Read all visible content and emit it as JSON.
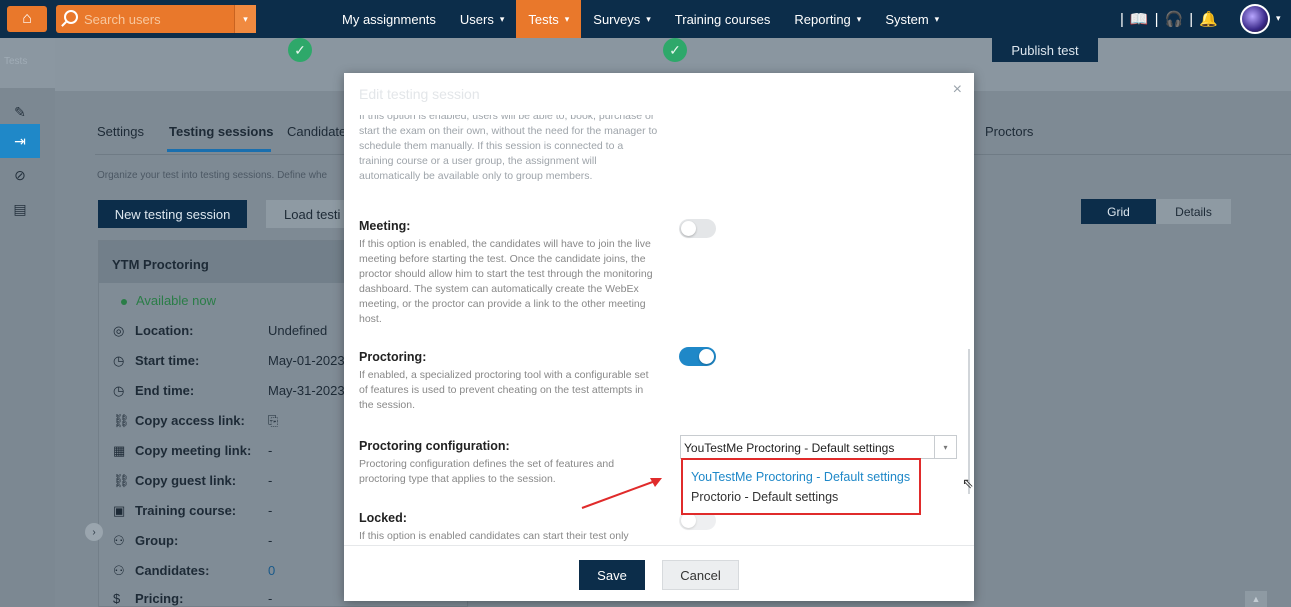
{
  "topbar": {
    "search_placeholder": "Search users",
    "nav": [
      {
        "label": "My assignments",
        "caret": false,
        "active": false
      },
      {
        "label": "Users",
        "caret": true,
        "active": false
      },
      {
        "label": "Tests",
        "caret": true,
        "active": true
      },
      {
        "label": "Surveys",
        "caret": true,
        "active": false
      },
      {
        "label": "Training courses",
        "caret": false,
        "active": false
      },
      {
        "label": "Reporting",
        "caret": true,
        "active": false
      },
      {
        "label": "System",
        "caret": true,
        "active": false
      }
    ]
  },
  "rail": {
    "top_label": "Tests"
  },
  "page": {
    "publish_label": "Publish test",
    "tabs": [
      "Settings",
      "Testing sessions",
      "Candidate"
    ],
    "proctors_tab": "Proctors",
    "description": "Organize your test into testing sessions. Define whe",
    "new_session_label": "New testing session",
    "load_label": "Load testi",
    "view_grid": "Grid",
    "view_details": "Details",
    "card": {
      "title": "YTM Proctoring",
      "status": "Available now",
      "rows": [
        {
          "icon": "◎",
          "label": "Location:",
          "value": "Undefined"
        },
        {
          "icon": "◷",
          "label": "Start time:",
          "value": "May-01-2023 1"
        },
        {
          "icon": "◷",
          "label": "End time:",
          "value": "May-31-2023 0"
        },
        {
          "icon": "⛓",
          "label": "Copy access link:",
          "value": "⎘"
        },
        {
          "icon": "▦",
          "label": "Copy meeting link:",
          "value": "-"
        },
        {
          "icon": "⛓",
          "label": "Copy guest link:",
          "value": "-"
        },
        {
          "icon": "▣",
          "label": "Training course:",
          "value": "-"
        },
        {
          "icon": "⚇",
          "label": "Group:",
          "value": "-"
        },
        {
          "icon": "⚇",
          "label": "Candidates:",
          "value": "0"
        },
        {
          "icon": "$",
          "label": "Pricing:",
          "value": "-"
        }
      ]
    }
  },
  "modal": {
    "title": "Edit testing session",
    "close": "×",
    "top_fade_text": "If this option is enabled, users will be able to, book, purchase or start the exam on their own, without the need for the manager to schedule them manually. If this session is connected to a training course or a user group, the assignment will automatically be available only to group members.",
    "meeting_title": "Meeting:",
    "meeting_desc": "If this option is enabled, the candidates will have to join the live meeting before starting the test. Once the candidate joins, the proctor should allow him to start the test through the monitoring dashboard. The system can automatically create the WebEx meeting, or the proctor can provide a link to the other meeting host.",
    "meeting_on": false,
    "proctoring_title": "Proctoring:",
    "proctoring_desc": "If enabled, a specialized proctoring tool with a configurable set of features is used to prevent cheating on the test attempts in the session.",
    "proctoring_on": true,
    "config_title": "Proctoring configuration:",
    "config_desc": "Proctoring configuration defines the set of features and proctoring type that applies to the session.",
    "config_selected": "YouTestMe Proctoring - Default settings",
    "config_options": [
      "YouTestMe Proctoring - Default settings",
      "Proctorio - Default settings"
    ],
    "locked_title": "Locked:",
    "locked_desc": "If this option is enabled candidates can start their test only",
    "locked_on": false,
    "save_label": "Save",
    "cancel_label": "Cancel"
  },
  "colors": {
    "navy": "#0c2d4a",
    "orange": "#e9782b",
    "accent_blue": "#1f88c8",
    "highlight_red": "#e02b2b"
  }
}
